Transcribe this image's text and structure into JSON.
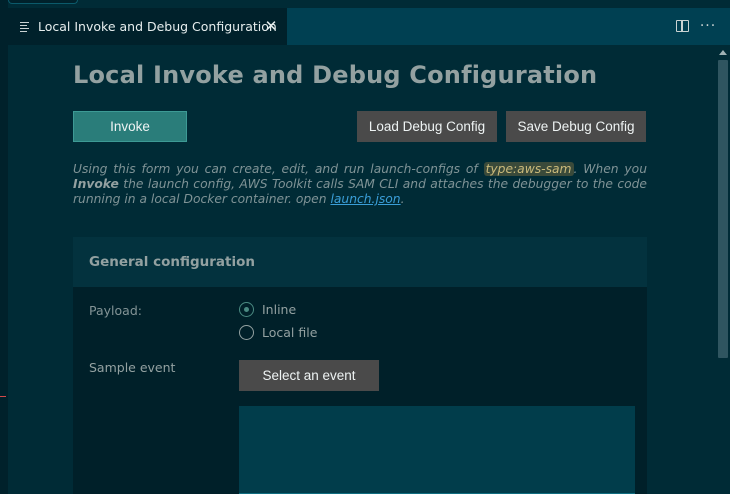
{
  "tab": {
    "title": "Local Invoke and Debug Configuration",
    "close_glyph": "✕"
  },
  "editor_actions": {
    "more_glyph": "···"
  },
  "page": {
    "title": "Local Invoke and Debug Configuration"
  },
  "buttons": {
    "invoke": "Invoke",
    "load": "Load Debug Config",
    "save": "Save Debug Config",
    "select_event": "Select an event"
  },
  "description": {
    "part1": "Using this form you can create, edit, and run launch-configs of ",
    "code": "type:aws-sam",
    "part2": ". When you ",
    "bold": "Invoke",
    "part3": " the launch config, AWS Toolkit calls SAM CLI and attaches the debugger to the code running in a local Docker container. open ",
    "link": "launch.json",
    "part4": "."
  },
  "general": {
    "title": "General configuration",
    "payload_label": "Payload:",
    "payload_options": [
      "Inline",
      "Local file"
    ],
    "payload_selected": "Inline",
    "sample_event_label": "Sample event",
    "event_text": ""
  },
  "colors": {
    "background": "#002b36",
    "invoke_button": "#2a7d7a",
    "secondary_button": "#4a4a4a",
    "link": "#3a9ed8"
  }
}
